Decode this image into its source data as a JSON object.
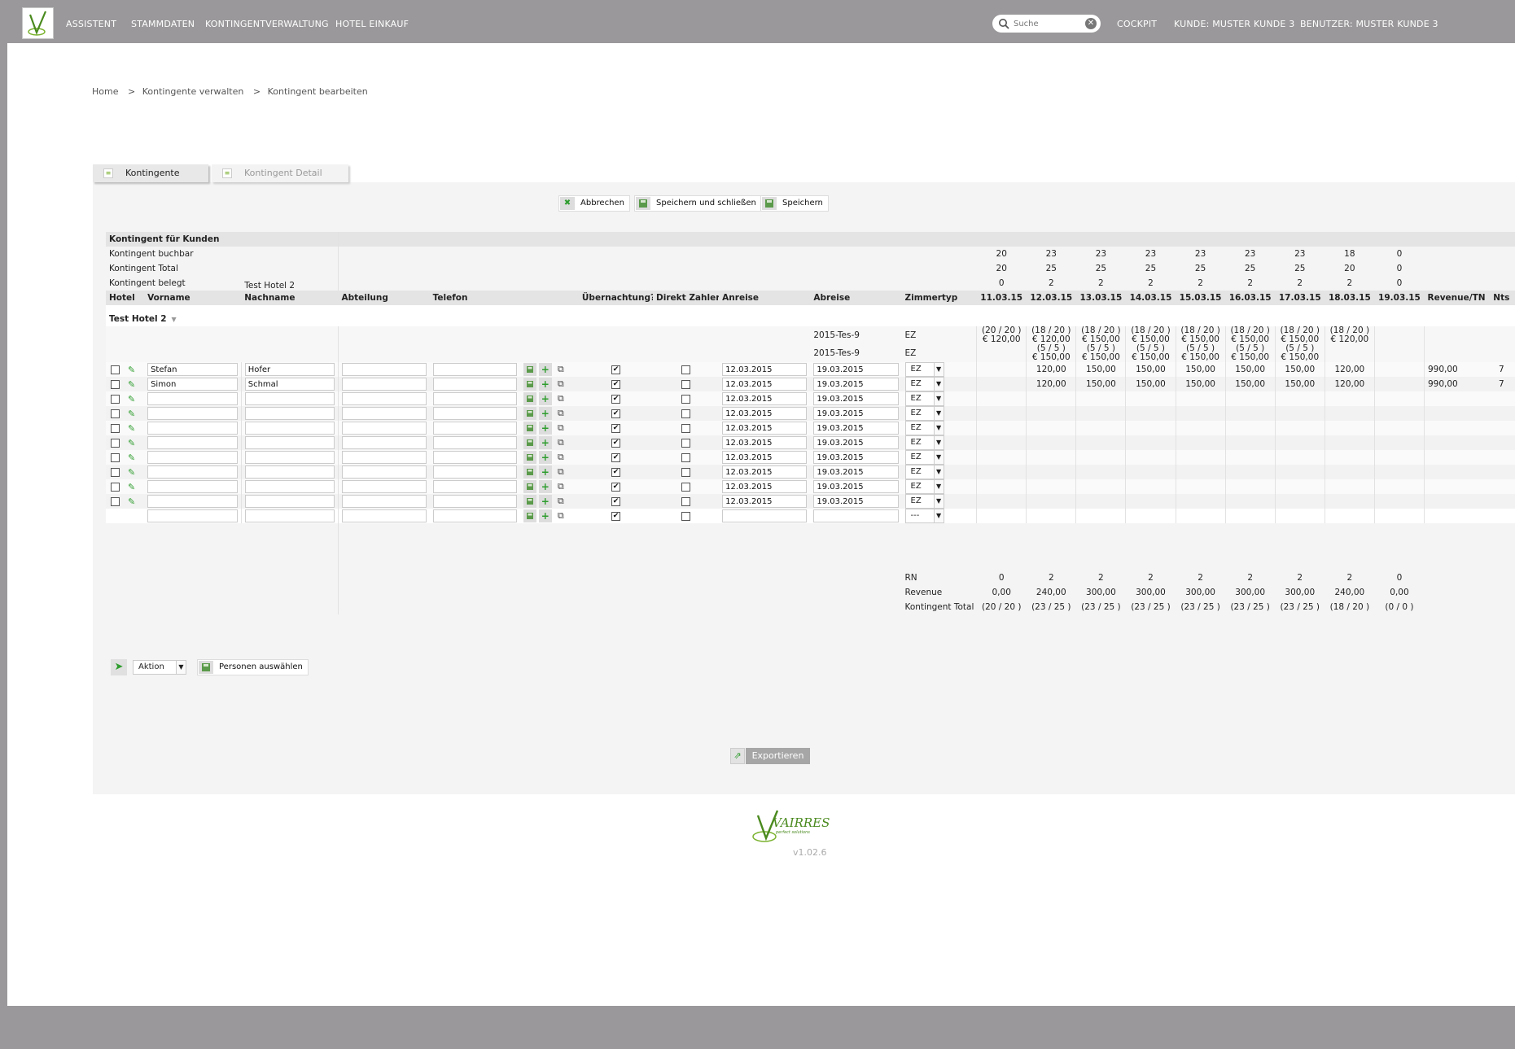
{
  "nav": {
    "items": [
      "ASSISTENT",
      "STAMMDATEN",
      "KONTINGENTVERWALTUNG",
      "HOTEL EINKAUF"
    ],
    "search_placeholder": "Suche",
    "cockpit": "COCKPIT",
    "customer": "KUNDE: MUSTER KUNDE 3",
    "user": "BENUTZER: MUSTER KUNDE 3"
  },
  "breadcrumb": {
    "home": "Home",
    "sep": ">",
    "level1": "Kontingente verwalten",
    "level2": "Kontingent bearbeiten"
  },
  "tabs": {
    "tab1": "Kontingente",
    "tab2": "Kontingent Detail"
  },
  "buttons": {
    "cancel": "Abbrechen",
    "save_close": "Speichern und schließen",
    "save": "Speichern",
    "persons": "Personen auswählen",
    "action": "Aktion",
    "export": "Exportieren"
  },
  "summary": {
    "title": "Kontingent für Kunden",
    "rows": [
      {
        "label": "Kontingent buchbar",
        "hotel": "",
        "values": [
          "20",
          "23",
          "23",
          "23",
          "23",
          "23",
          "23",
          "18",
          "0"
        ]
      },
      {
        "label": "Kontingent Total",
        "hotel": "",
        "values": [
          "20",
          "25",
          "25",
          "25",
          "25",
          "25",
          "25",
          "20",
          "0"
        ]
      },
      {
        "label": "Kontingent belegt",
        "hotel": "Test Hotel 2",
        "values": [
          "0",
          "2",
          "2",
          "2",
          "2",
          "2",
          "2",
          "2",
          "0"
        ]
      }
    ]
  },
  "columns": [
    "Hotel",
    "Vorname",
    "Nachname",
    "Abteilung",
    "Telefon",
    "",
    "Übernachtung?",
    "Direkt Zahler",
    "Anreise",
    "Abreise",
    "Zimmertyp",
    "11.03.15",
    "12.03.15",
    "13.03.15",
    "14.03.15",
    "15.03.15",
    "16.03.15",
    "17.03.15",
    "18.03.15",
    "19.03.15",
    "Revenue/TN",
    "Nts"
  ],
  "group": {
    "name": "Test Hotel 2",
    "chevron": "▼"
  },
  "info_rows": [
    {
      "code": "2015-Tes-9",
      "type": "EZ",
      "cells": [
        [
          "(20 / 20 )",
          "€ 120,00"
        ],
        [
          "(18 / 20 )",
          "€ 120,00"
        ],
        [
          "(18 / 20 )",
          "€ 150,00"
        ],
        [
          "(18 / 20 )",
          "€ 150,00"
        ],
        [
          "(18 / 20 )",
          "€ 150,00"
        ],
        [
          "(18 / 20 )",
          "€ 150,00"
        ],
        [
          "(18 / 20 )",
          "€ 150,00"
        ],
        [
          "(18 / 20 )",
          "€ 120,00"
        ],
        [
          "",
          ""
        ]
      ]
    },
    {
      "code": "2015-Tes-9",
      "type": "EZ",
      "cells": [
        [
          "",
          ""
        ],
        [
          "(5 / 5 )",
          "€ 150,00"
        ],
        [
          "(5 / 5 )",
          "€ 150,00"
        ],
        [
          "(5 / 5 )",
          "€ 150,00"
        ],
        [
          "(5 / 5 )",
          "€ 150,00"
        ],
        [
          "(5 / 5 )",
          "€ 150,00"
        ],
        [
          "(5 / 5 )",
          "€ 150,00"
        ],
        [
          "",
          ""
        ],
        [
          "",
          ""
        ]
      ]
    }
  ],
  "persons": [
    {
      "first": "Stefan",
      "last": "Hofer",
      "arrive": "12.03.2015",
      "depart": "19.03.2015",
      "room": "EZ",
      "days": [
        "",
        "120,00",
        "150,00",
        "150,00",
        "150,00",
        "150,00",
        "150,00",
        "120,00",
        ""
      ],
      "revenue": "990,00",
      "nts": "7"
    },
    {
      "first": "Simon",
      "last": "Schmal",
      "arrive": "12.03.2015",
      "depart": "19.03.2015",
      "room": "EZ",
      "days": [
        "",
        "120,00",
        "150,00",
        "150,00",
        "150,00",
        "150,00",
        "150,00",
        "120,00",
        ""
      ],
      "revenue": "990,00",
      "nts": "7"
    },
    {
      "first": "",
      "last": "",
      "arrive": "12.03.2015",
      "depart": "19.03.2015",
      "room": "EZ",
      "days": [
        "",
        "",
        "",
        "",
        "",
        "",
        "",
        "",
        ""
      ],
      "revenue": "",
      "nts": ""
    },
    {
      "first": "",
      "last": "",
      "arrive": "12.03.2015",
      "depart": "19.03.2015",
      "room": "EZ",
      "days": [
        "",
        "",
        "",
        "",
        "",
        "",
        "",
        "",
        ""
      ],
      "revenue": "",
      "nts": ""
    },
    {
      "first": "",
      "last": "",
      "arrive": "12.03.2015",
      "depart": "19.03.2015",
      "room": "EZ",
      "days": [
        "",
        "",
        "",
        "",
        "",
        "",
        "",
        "",
        ""
      ],
      "revenue": "",
      "nts": ""
    },
    {
      "first": "",
      "last": "",
      "arrive": "12.03.2015",
      "depart": "19.03.2015",
      "room": "EZ",
      "days": [
        "",
        "",
        "",
        "",
        "",
        "",
        "",
        "",
        ""
      ],
      "revenue": "",
      "nts": ""
    },
    {
      "first": "",
      "last": "",
      "arrive": "12.03.2015",
      "depart": "19.03.2015",
      "room": "EZ",
      "days": [
        "",
        "",
        "",
        "",
        "",
        "",
        "",
        "",
        ""
      ],
      "revenue": "",
      "nts": ""
    },
    {
      "first": "",
      "last": "",
      "arrive": "12.03.2015",
      "depart": "19.03.2015",
      "room": "EZ",
      "days": [
        "",
        "",
        "",
        "",
        "",
        "",
        "",
        "",
        ""
      ],
      "revenue": "",
      "nts": ""
    },
    {
      "first": "",
      "last": "",
      "arrive": "12.03.2015",
      "depart": "19.03.2015",
      "room": "EZ",
      "days": [
        "",
        "",
        "",
        "",
        "",
        "",
        "",
        "",
        ""
      ],
      "revenue": "",
      "nts": ""
    },
    {
      "first": "",
      "last": "",
      "arrive": "12.03.2015",
      "depart": "19.03.2015",
      "room": "EZ",
      "days": [
        "",
        "",
        "",
        "",
        "",
        "",
        "",
        "",
        ""
      ],
      "revenue": "",
      "nts": ""
    }
  ],
  "new_row": {
    "room": "---"
  },
  "totals": [
    {
      "label": "RN",
      "values": [
        "0",
        "2",
        "2",
        "2",
        "2",
        "2",
        "2",
        "2",
        "0"
      ]
    },
    {
      "label": "Revenue",
      "values": [
        "0,00",
        "240,00",
        "300,00",
        "300,00",
        "300,00",
        "300,00",
        "300,00",
        "240,00",
        "0,00"
      ]
    },
    {
      "label": "Kontingent Total",
      "values": [
        "(20 / 20 )",
        "(23 / 25 )",
        "(23 / 25 )",
        "(23 / 25 )",
        "(23 / 25 )",
        "(23 / 25 )",
        "(23 / 25 )",
        "(18 / 20 )",
        "(0 / 0 )"
      ]
    }
  ],
  "footer": {
    "brand": "VAIRRES",
    "tagline": "perfect solutions",
    "version": "v1.02.6"
  },
  "colors": {
    "accent": "#7ab22e",
    "topbar": "#9a989a",
    "header_row": "#e4e4e4"
  },
  "icons": {
    "logo": "vairres-logo",
    "search": "search-icon",
    "clear": "clear-icon",
    "save": "save-icon",
    "cancel": "cancel-icon",
    "add": "plus-icon",
    "copy": "copy-icon",
    "edit": "edit-icon",
    "go": "arrow-right-icon",
    "export": "export-icon"
  }
}
